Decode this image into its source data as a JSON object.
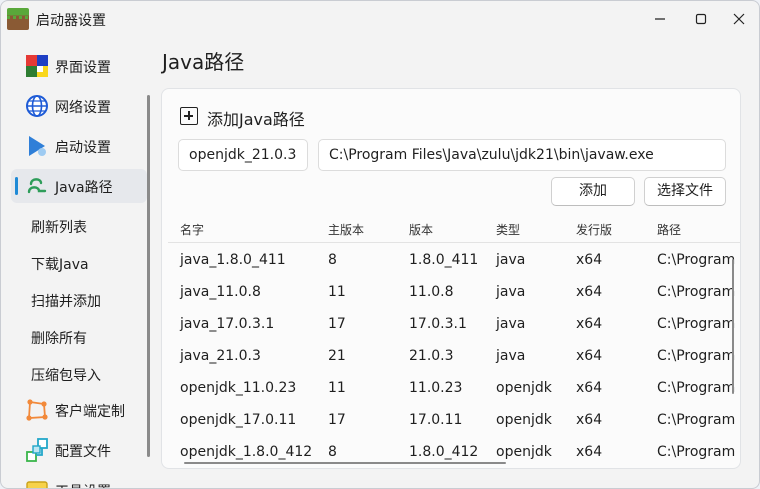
{
  "window": {
    "title": "启动器设置"
  },
  "sidebar": {
    "items": [
      {
        "label": "界面设置",
        "icon": "palette-icon"
      },
      {
        "label": "网络设置",
        "icon": "globe-icon"
      },
      {
        "label": "启动设置",
        "icon": "launch-icon"
      },
      {
        "label": "Java路径",
        "icon": "java-path-icon"
      },
      {
        "label": "客户端定制",
        "icon": "customize-icon"
      },
      {
        "label": "配置文件",
        "icon": "config-file-icon"
      },
      {
        "label": "工具设置",
        "icon": "tools-icon"
      }
    ],
    "sub_items": [
      "刷新列表",
      "下载Java",
      "扫描并添加",
      "删除所有",
      "压缩包导入"
    ]
  },
  "page": {
    "title": "Java路径"
  },
  "add_section": {
    "title": "添加Java路径",
    "name_value": "openjdk_21.0.3",
    "path_value": "C:\\Program Files\\Java\\zulu\\jdk21\\bin\\javaw.exe",
    "add_button": "添加",
    "choose_file_button": "选择文件"
  },
  "table": {
    "columns": [
      "名字",
      "主版本",
      "版本",
      "类型",
      "发行版",
      "路径"
    ],
    "rows": [
      [
        "java_1.8.0_411",
        "8",
        "1.8.0_411",
        "java",
        "x64",
        "C:\\Program"
      ],
      [
        "java_11.0.8",
        "11",
        "11.0.8",
        "java",
        "x64",
        "C:\\Program"
      ],
      [
        "java_17.0.3.1",
        "17",
        "17.0.3.1",
        "java",
        "x64",
        "C:\\Program"
      ],
      [
        "java_21.0.3",
        "21",
        "21.0.3",
        "java",
        "x64",
        "C:\\Program"
      ],
      [
        "openjdk_11.0.23",
        "11",
        "11.0.23",
        "openjdk",
        "x64",
        "C:\\Program"
      ],
      [
        "openjdk_17.0.11",
        "17",
        "17.0.11",
        "openjdk",
        "x64",
        "C:\\Program"
      ],
      [
        "openjdk_1.8.0_412",
        "8",
        "1.8.0_412",
        "openjdk",
        "x64",
        "C:\\Program"
      ]
    ]
  },
  "colors": {
    "accent": "#1f8ad6"
  }
}
